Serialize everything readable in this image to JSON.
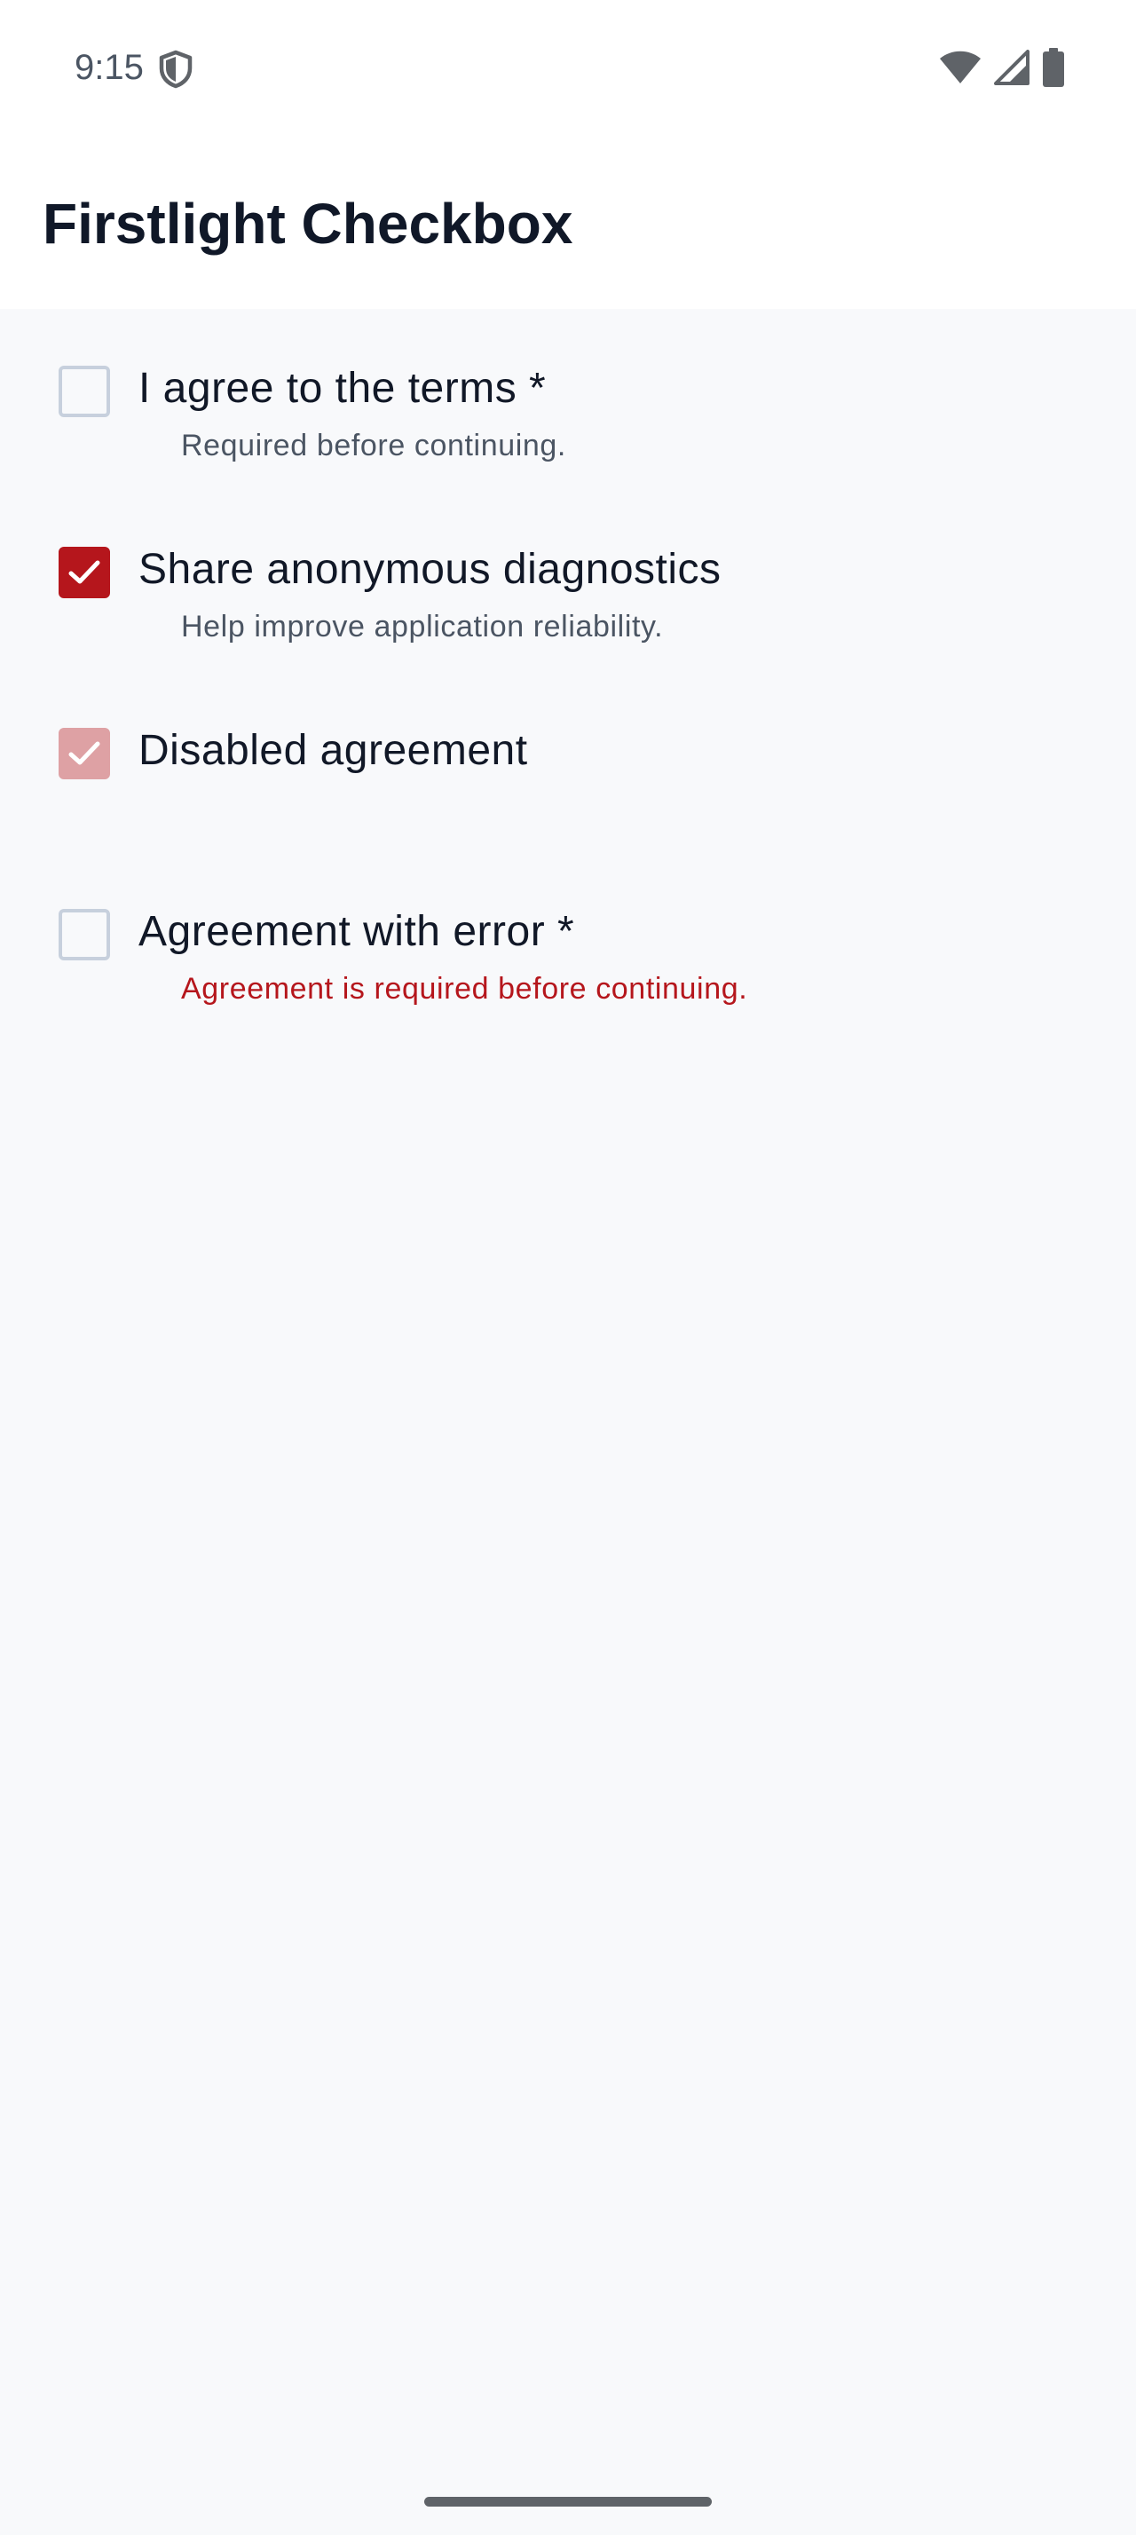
{
  "status_bar": {
    "time": "9:15",
    "left_icon": "shield-icon",
    "right_icons": [
      "wifi-icon",
      "cellular-signal-icon",
      "battery-icon"
    ]
  },
  "app_bar": {
    "title": "Firstlight Checkbox"
  },
  "checkboxes": [
    {
      "label": "I agree to the terms *",
      "helper": "Required before continuing.",
      "checked": false,
      "disabled": false,
      "error": false
    },
    {
      "label": "Share anonymous diagnostics",
      "helper": "Help improve application reliability.",
      "checked": true,
      "disabled": false,
      "error": false
    },
    {
      "label": "Disabled agreement",
      "helper": "",
      "checked": true,
      "disabled": true,
      "error": false
    },
    {
      "label": "Agreement with error *",
      "helper": "Agreement is required before continuing.",
      "checked": false,
      "disabled": false,
      "error": true
    }
  ],
  "colors": {
    "accent": "#b5161c",
    "disabled_accent": "#dea1a4",
    "unchecked_border": "#c7d0dd",
    "background": "#f8f9fb",
    "error_text": "#b5161c",
    "helper_text": "#4b5563"
  }
}
